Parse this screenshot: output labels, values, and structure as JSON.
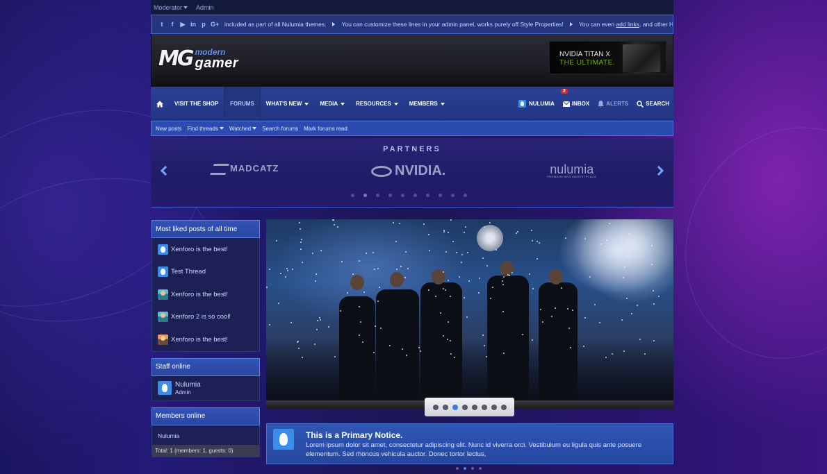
{
  "topbar": {
    "moderator": "Moderator",
    "admin": "Admin"
  },
  "ticker": {
    "social_icons": [
      "twitter-icon",
      "facebook-icon",
      "youtube-icon",
      "linkedin-icon",
      "pinterest-icon",
      "google-plus-icon"
    ],
    "msg1": "included as part of all Nulumia themes.",
    "msg2": "You can customize these lines in your admin panel, works purely off Style Properties!",
    "msg3_pre": "You can even",
    "msg3_link": "add links",
    "msg3_post": ", and other HTML mark"
  },
  "logo": {
    "mark": "MG",
    "word1": "modern",
    "word2": "gamer"
  },
  "ad": {
    "line1": "NVIDIA TITAN X",
    "line2": "THE ULTIMATE."
  },
  "nav": {
    "shop": "Visit the Shop",
    "forums": "Forums",
    "whats_new": "What's New",
    "media": "Media",
    "resources": "Resources",
    "members": "Members",
    "user": "Nulumia",
    "inbox": "Inbox",
    "inbox_count": "2",
    "alerts": "Alerts",
    "search": "Search"
  },
  "subnav": {
    "new_posts": "New posts",
    "find_threads": "Find threads",
    "watched": "Watched",
    "search_forums": "Search forums",
    "mark_read": "Mark forums read"
  },
  "partners": {
    "title": "PARTNERS",
    "logos": [
      "MADCATZ",
      "NVIDIA.",
      "nulumia"
    ],
    "nulumia_sub": "PREMIUM WEB MARKETPLACE"
  },
  "sidebar": {
    "liked_title": "Most liked posts of all time",
    "liked": [
      "Xenforo is the best!",
      "Test Thread",
      "Xenforo is the best!",
      "Xenforo 2 is so cool!",
      "Xenforo is the best!"
    ],
    "staff_title": "Staff online",
    "staff_name": "Nulumia",
    "staff_role": "Admin",
    "members_title": "Members online",
    "member_name": "Nulumia",
    "members_total": "Total: 1 (members: 1, guests: 0)"
  },
  "slider": {
    "dots": 8,
    "active": 3
  },
  "notice": {
    "title": "This is a Primary Notice.",
    "text": "Lorem ipsum dolor sit amet, consectetur adipiscing elit. Nunc id viverra orci. Vestibulum eu ligula quis ante posuere elementum. Sed rhoncus vehicula auctor. Donec tortor lectus,"
  },
  "colors": {
    "accent": "#3a8de8",
    "nav": "#2a4198",
    "badge": "#d42b2b"
  }
}
